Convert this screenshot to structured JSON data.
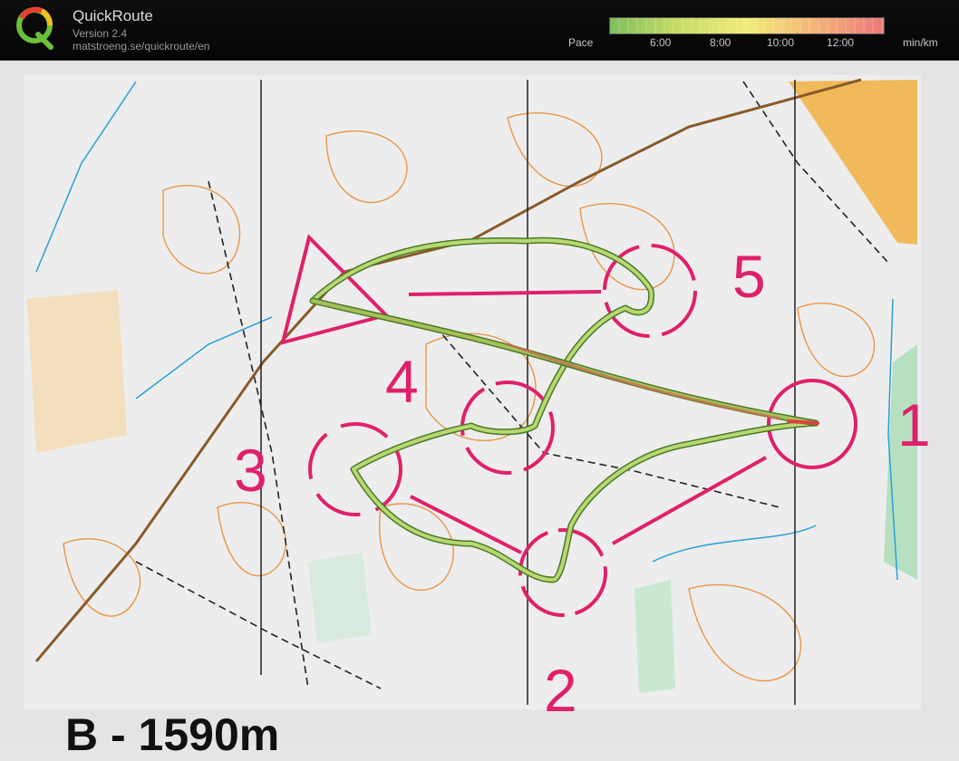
{
  "header": {
    "app_title": "QuickRoute",
    "version": "Version 2.4",
    "url": "matstroeng.se/quickroute/en",
    "pace_label": "Pace",
    "pace_unit": "min/km",
    "pace_ticks": [
      "6:00",
      "8:00",
      "10:00",
      "12:00"
    ],
    "pace_colors": [
      "#7fbf5f",
      "#c8dc64",
      "#f0ec78",
      "#f4b478",
      "#ec7878"
    ]
  },
  "map": {
    "controls": [
      "1",
      "2",
      "3",
      "4",
      "5"
    ],
    "course_title": "B - 1590m",
    "colors": {
      "course": "#e0206a",
      "contour": "#e8862a",
      "water": "#2a9fd8",
      "route": "#6aa040"
    }
  }
}
